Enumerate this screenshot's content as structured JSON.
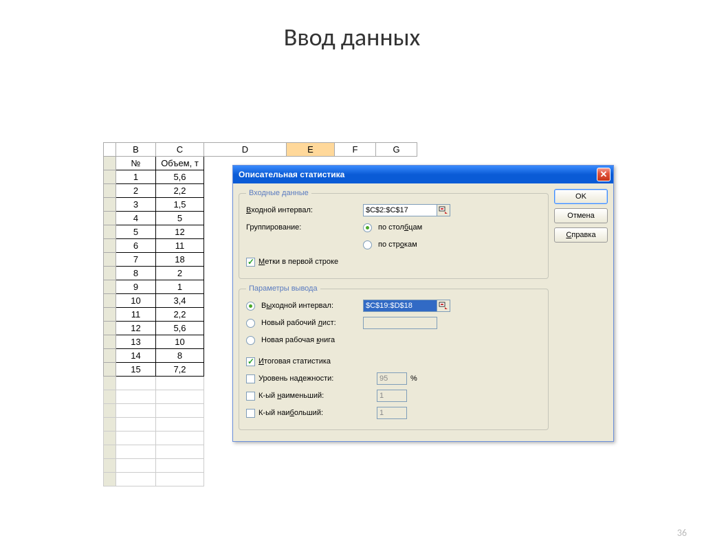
{
  "slide": {
    "title": "Ввод данных",
    "pageNumber": "36"
  },
  "sheet": {
    "cols": [
      "",
      "B",
      "C",
      "D",
      "E",
      "F",
      "G"
    ],
    "header": {
      "B": "№",
      "C": "Объем, т"
    },
    "rows": [
      {
        "B": "1",
        "C": "5,6"
      },
      {
        "B": "2",
        "C": "2,2"
      },
      {
        "B": "3",
        "C": "1,5"
      },
      {
        "B": "4",
        "C": "5"
      },
      {
        "B": "5",
        "C": "12"
      },
      {
        "B": "6",
        "C": "11"
      },
      {
        "B": "7",
        "C": "18"
      },
      {
        "B": "8",
        "C": "2"
      },
      {
        "B": "9",
        "C": "1"
      },
      {
        "B": "10",
        "C": "3,4"
      },
      {
        "B": "11",
        "C": "2,2"
      },
      {
        "B": "12",
        "C": "5,6"
      },
      {
        "B": "13",
        "C": "10"
      },
      {
        "B": "14",
        "C": "8"
      },
      {
        "B": "15",
        "C": "7,2"
      }
    ]
  },
  "dialog": {
    "title": "Описательная статистика",
    "input_group": "Входные данные",
    "input_range_label": "Входной интервал:",
    "input_range_value": "$C$2:$C$17",
    "grouping_label": "Группирование:",
    "by_columns": "по столбцам",
    "by_rows": "по строкам",
    "labels_first_row": "Метки в первой строке",
    "output_group": "Параметры вывода",
    "output_range_label": "Выходной интервал:",
    "output_range_value": "$C$19:$D$18",
    "new_worksheet": "Новый рабочий лист:",
    "new_workbook": "Новая рабочая книга",
    "summary_stats": "Итоговая статистика",
    "confidence_label": "Уровень надежности:",
    "confidence_value": "95",
    "confidence_unit": "%",
    "kth_smallest": "К-ый наименьший:",
    "kth_largest": "К-ый наибольший:",
    "kth_value": "1",
    "ok": "OK",
    "cancel": "Отмена",
    "help": "Справка",
    "u_input": "В",
    "u_group": "б",
    "u_rows": "о",
    "u_labels": "М",
    "u_output": "ы",
    "u_sheet": "л",
    "u_book": "к",
    "u_summary": "И",
    "u_conf": "",
    "u_small": "н",
    "u_large": "б",
    "u_help": "С"
  }
}
